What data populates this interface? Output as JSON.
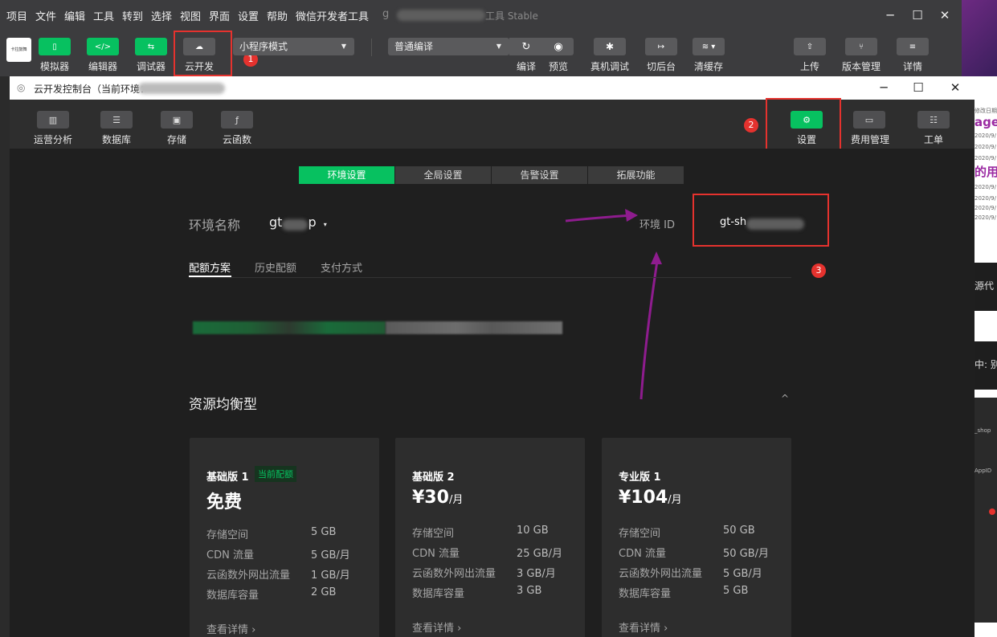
{
  "menubar": {
    "items": [
      "项目",
      "文件",
      "编辑",
      "工具",
      "转到",
      "选择",
      "视图",
      "界面",
      "设置",
      "帮助",
      "微信开发者工具"
    ],
    "title_prefix": "g",
    "title_suffix": "工具 Stable"
  },
  "toolbar": {
    "logo_text": "卡拉鼓舞",
    "buttons": [
      {
        "label": "模拟器",
        "icon": "phone-icon"
      },
      {
        "label": "编辑器",
        "icon": "code-icon"
      },
      {
        "label": "调试器",
        "icon": "debug-toggle-icon"
      },
      {
        "label": "云开发",
        "icon": "cloud-icon"
      }
    ],
    "mode_select": "小程序模式",
    "compile_select": "普通编译",
    "actions": [
      {
        "label": "编译",
        "icon": "refresh-icon"
      },
      {
        "label": "预览",
        "icon": "eye-icon"
      },
      {
        "label": "真机调试",
        "icon": "bug-icon"
      },
      {
        "label": "切后台",
        "icon": "switch-icon"
      },
      {
        "label": "清缓存",
        "icon": "layers-icon"
      }
    ],
    "right_actions": [
      {
        "label": "上传",
        "icon": "upload-icon"
      },
      {
        "label": "版本管理",
        "icon": "branch-icon"
      },
      {
        "label": "详情",
        "icon": "menu-icon"
      }
    ]
  },
  "annotations": {
    "badge1": "1",
    "badge2": "2",
    "badge3": "3"
  },
  "dialog": {
    "title": "云开发控制台（当前环境：",
    "nav_left": [
      {
        "label": "运营分析",
        "icon": "chart-icon"
      },
      {
        "label": "数据库",
        "icon": "database-icon"
      },
      {
        "label": "存储",
        "icon": "save-icon"
      },
      {
        "label": "云函数",
        "icon": "function-icon"
      }
    ],
    "nav_right": [
      {
        "label": "设置",
        "icon": "gear-icon"
      },
      {
        "label": "费用管理",
        "icon": "billing-icon"
      },
      {
        "label": "工单",
        "icon": "ticket-icon"
      }
    ],
    "tabs": [
      "环境设置",
      "全局设置",
      "告警设置",
      "拓展功能"
    ],
    "env": {
      "name_label": "环境名称",
      "name_value": "gt",
      "name_suffix": "p",
      "id_label": "环境 ID",
      "id_value": "gt-sh"
    },
    "subtabs": [
      "配额方案",
      "历史配额",
      "支付方式"
    ],
    "section_title": "资源均衡型",
    "plans": [
      {
        "name": "基础版 1",
        "tag": "当前配额",
        "price": "免费",
        "unit": "",
        "specs": [
          {
            "k": "存储空间",
            "v": "5 GB"
          },
          {
            "k": "CDN 流量",
            "v": "5 GB/月"
          },
          {
            "k": "云函数外网出流量",
            "v": "1 GB/月"
          },
          {
            "k": "数据库容量",
            "v": "2 GB"
          }
        ],
        "link": "查看详情 ›"
      },
      {
        "name": "基础版 2",
        "tag": "",
        "price": "¥30",
        "unit": "/月",
        "specs": [
          {
            "k": "存储空间",
            "v": "10 GB"
          },
          {
            "k": "CDN 流量",
            "v": "25 GB/月"
          },
          {
            "k": "云函数外网出流量",
            "v": "3 GB/月"
          },
          {
            "k": "数据库容量",
            "v": "3 GB"
          }
        ],
        "link": "查看详情 ›"
      },
      {
        "name": "专业版 1",
        "tag": "",
        "price": "¥104",
        "unit": "/月",
        "specs": [
          {
            "k": "存储空间",
            "v": "50 GB"
          },
          {
            "k": "CDN 流量",
            "v": "50 GB/月"
          },
          {
            "k": "云函数外网出流量",
            "v": "5 GB/月"
          },
          {
            "k": "数据库容量",
            "v": "5 GB"
          }
        ],
        "link": "查看详情 ›"
      }
    ]
  },
  "background_window": {
    "lines": [
      "修改日期",
      "age",
      "2020/9/",
      "2020/9/",
      "2020/9/",
      "的用",
      "2020/9/",
      "2020/9/",
      "2020/9/",
      "2020/9/",
      "源代",
      "中: 别",
      "_shop",
      "AppID"
    ]
  },
  "colors": {
    "accent": "#07c160",
    "annotation": "#e5322e",
    "arrow": "#8e1c8e"
  }
}
